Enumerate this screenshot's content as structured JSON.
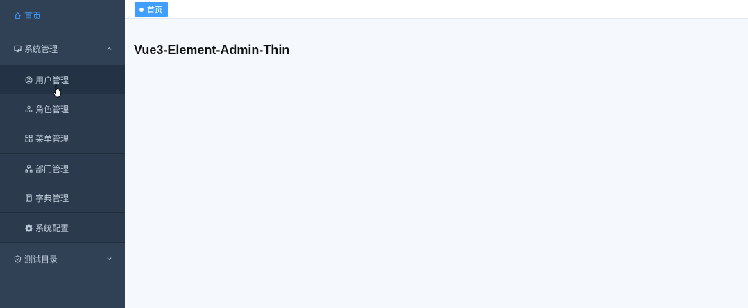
{
  "sidebar": {
    "home": {
      "label": "首页",
      "icon": "home-icon"
    },
    "system": {
      "label": "系统管理",
      "icon": "monitor-icon",
      "expanded": true,
      "items": [
        {
          "label": "用户管理",
          "icon": "user-icon",
          "active": true
        },
        {
          "label": "角色管理",
          "icon": "role-icon"
        },
        {
          "label": "菜单管理",
          "icon": "menu-grid-icon"
        },
        {
          "label": "部门管理",
          "icon": "department-icon"
        },
        {
          "label": "字典管理",
          "icon": "dictionary-icon"
        },
        {
          "label": "系统配置",
          "icon": "gear-icon"
        }
      ]
    },
    "test": {
      "label": "测试目录",
      "icon": "shield-icon",
      "expanded": false
    }
  },
  "tags": [
    {
      "label": "首页",
      "active": true
    }
  ],
  "main": {
    "title": "Vue3-Element-Admin-Thin"
  },
  "colors": {
    "sidebar_bg": "#304156",
    "submenu_bg": "#1f2d3d",
    "accent": "#409eff",
    "content_bg": "#f5f9fe"
  }
}
